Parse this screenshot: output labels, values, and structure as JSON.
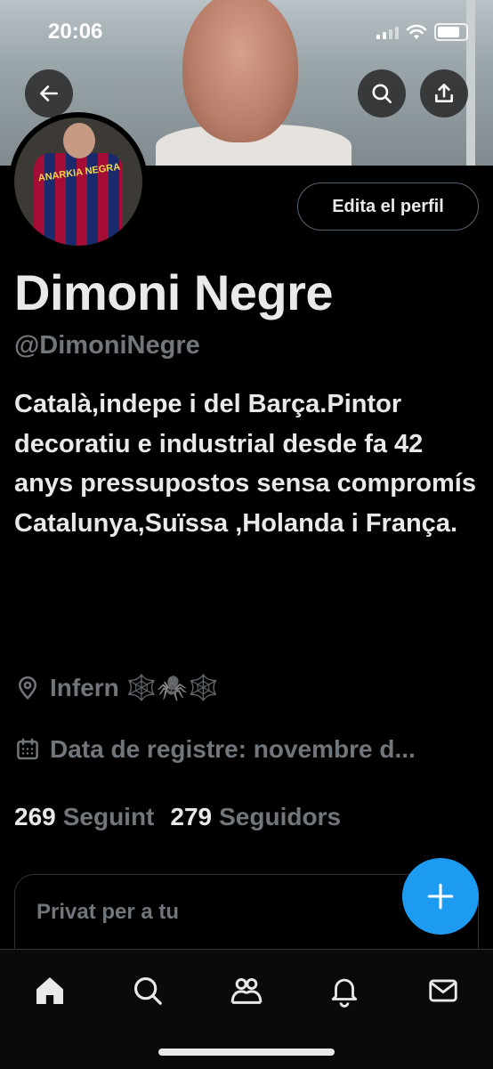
{
  "status_bar": {
    "time": "20:06"
  },
  "header": {
    "back_icon": "arrow-left-icon",
    "search_icon": "search-icon",
    "share_icon": "share-icon"
  },
  "profile": {
    "avatar_jersey_text": "ANARKIA NEGRA",
    "edit_button_label": "Edita el perfil",
    "display_name": "Dimoni Negre",
    "handle": "@DimoniNegre",
    "bio": "Català,indepe i del Barça.Pintor decoratiu e industrial desde fa 42 anys pressupostos sensa compromís Catalunya,Suïssa ,Holanda i França.",
    "location": "Infern 🕸️🕷️🕸️",
    "joined": "Data de registre: novembre d...",
    "following_count": "269",
    "following_label": "Seguint",
    "followers_count": "279",
    "followers_label": "Seguidors"
  },
  "private_card": {
    "label": "Privat per a tu"
  },
  "fab": {
    "icon": "plus-icon"
  },
  "tabbar": {
    "items": [
      {
        "icon": "home-icon"
      },
      {
        "icon": "search-icon"
      },
      {
        "icon": "communities-icon"
      },
      {
        "icon": "notifications-icon"
      },
      {
        "icon": "messages-icon"
      }
    ]
  },
  "colors": {
    "accent": "#1d9bf0",
    "background": "#000000",
    "secondary_text": "#71767b",
    "primary_text": "#e7e9ea"
  }
}
